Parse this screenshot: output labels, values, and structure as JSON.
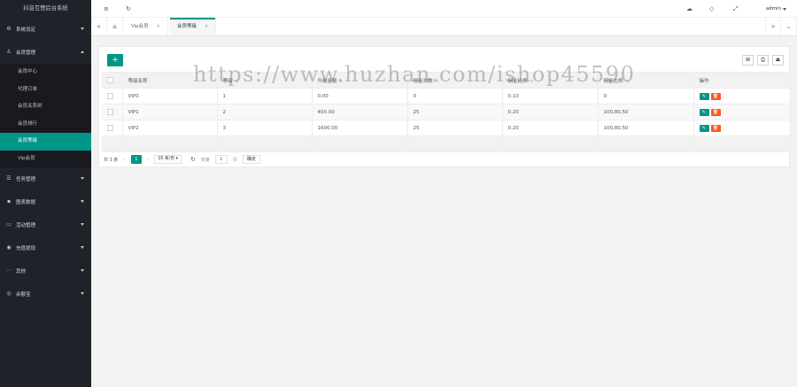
{
  "app": {
    "title": "抖音互赞后台系统"
  },
  "sidebar": {
    "groups": [
      {
        "label": "系统设定",
        "icon": "gear-icon"
      },
      {
        "label": "会员管理",
        "icon": "user-icon",
        "expanded": true,
        "items": [
          "会员中心",
          "代理订单",
          "会员关系树",
          "会员排行",
          "会员等级",
          "Vip会员"
        ]
      },
      {
        "label": "任务管理",
        "icon": "task-icon"
      },
      {
        "label": "图表数据",
        "icon": "chart-icon"
      },
      {
        "label": "活动管理",
        "icon": "activity-icon"
      },
      {
        "label": "充值提现",
        "icon": "recharge-icon"
      },
      {
        "label": "其他",
        "icon": "more-icon"
      },
      {
        "label": "余额宝",
        "icon": "balance-icon"
      }
    ]
  },
  "header": {
    "user": "admin"
  },
  "tabs": [
    {
      "label": "Vip会员"
    },
    {
      "label": "会员等级",
      "active": true
    }
  ],
  "table": {
    "headers": [
      "等级名称",
      "等级",
      "升级金额",
      "佣金次数",
      "佣金比例",
      "佣金比例",
      "操作"
    ],
    "rows": [
      [
        "VIP0",
        "1",
        "0.00",
        "0",
        "0.10",
        "0"
      ],
      [
        "VIP1",
        "2",
        "400.00",
        "25",
        "0.20",
        "100,80,50"
      ],
      [
        "VIP2",
        "3",
        "1600.00",
        "25",
        "0.20",
        "100,80,50"
      ]
    ]
  },
  "pager": {
    "total": "共 3 条",
    "current": "1",
    "per_page": "10 条/页",
    "goto_label": "到第",
    "goto_value": "1",
    "page_unit": "页",
    "confirm": "确定"
  },
  "watermark": "https://www.huzhan.com/ishop45590",
  "colors": {
    "primary": "#009688",
    "danger": "#ff5722",
    "sidebar": "#20222a"
  }
}
